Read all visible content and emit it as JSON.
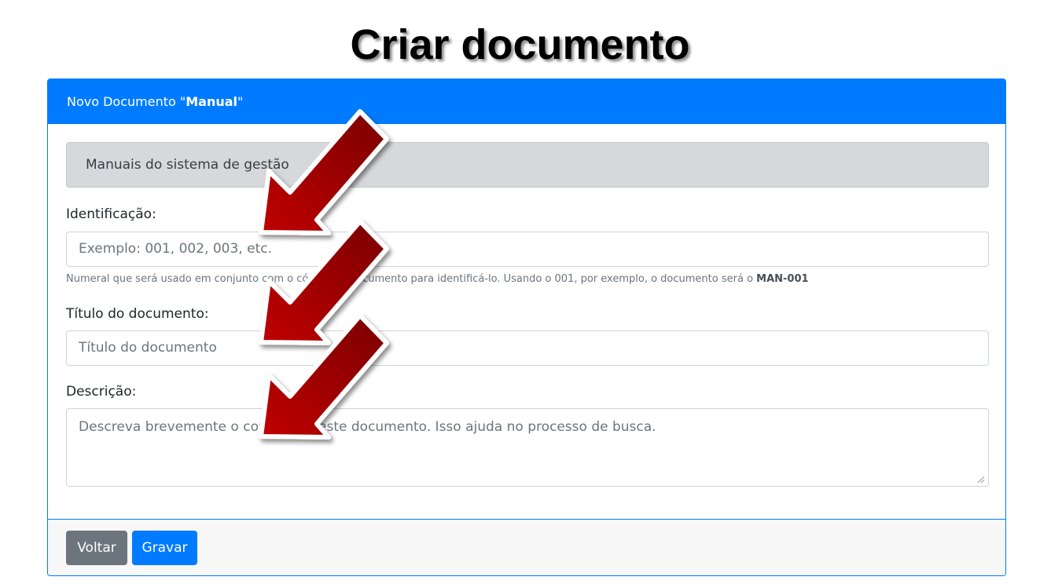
{
  "slide": {
    "title": "Criar documento"
  },
  "card": {
    "header_prefix": "Novo Documento \"",
    "header_bold": "Manual",
    "header_suffix": "\""
  },
  "alert": {
    "text": "Manuais do sistema de gestão"
  },
  "form": {
    "identificacao_label": "Identificação:",
    "identificacao_placeholder": "Exemplo: 001, 002, 003, etc.",
    "identificacao_help_prefix": "Numeral que será usado em conjunto com o código do documento para identificá-lo. Usando o 001, por exemplo, o documento será o ",
    "identificacao_help_bold": "MAN-001",
    "titulo_label": "Título do documento:",
    "titulo_placeholder": "Título do documento",
    "descricao_label": "Descrição:",
    "descricao_placeholder": "Descreva brevemente o conteúdo deste documento. Isso ajuda no processo de busca."
  },
  "footer": {
    "back_label": "Voltar",
    "save_label": "Gravar"
  },
  "colors": {
    "primary": "#007bff",
    "secondary": "#6c757d",
    "alert_bg": "#d6d8db",
    "arrow": "#b00000"
  },
  "annotations": [
    "red-arrow-icon",
    "red-arrow-icon",
    "red-arrow-icon"
  ]
}
